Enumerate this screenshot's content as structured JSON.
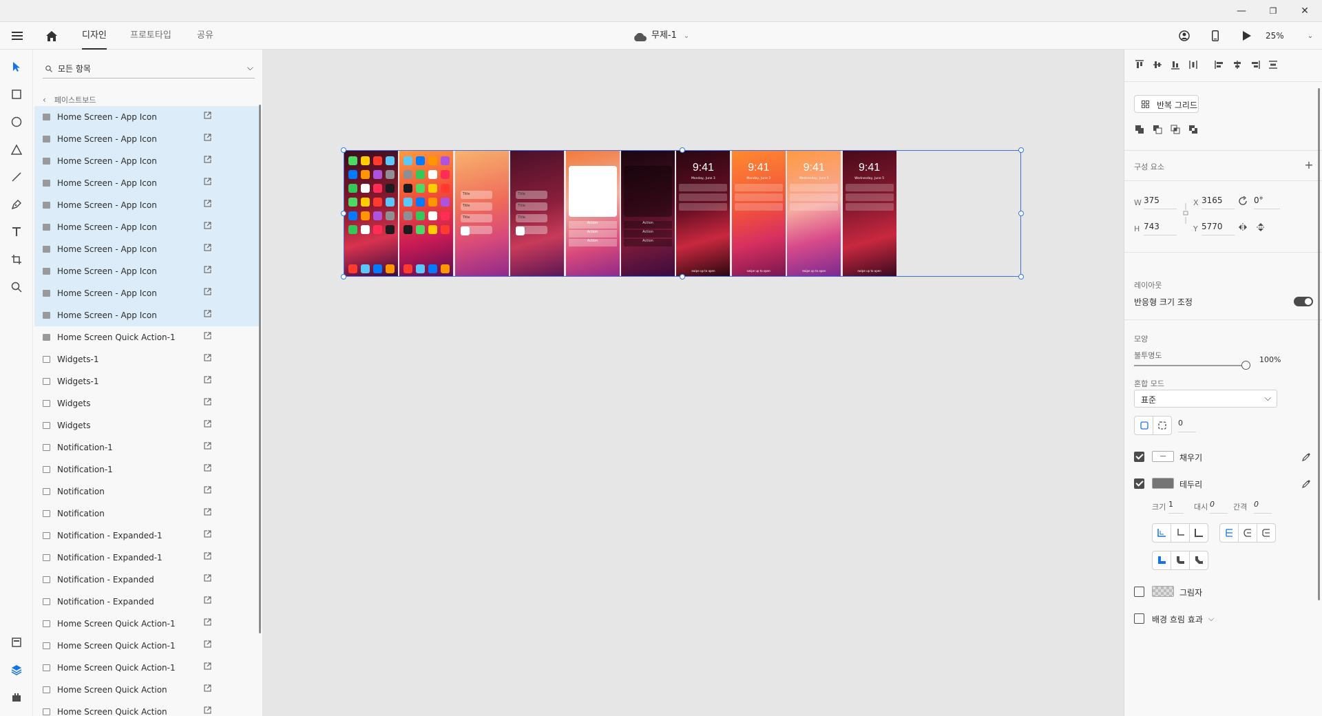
{
  "window": {
    "minimize": "—",
    "restore": "❐",
    "close": "✕"
  },
  "appbar": {
    "tabs": [
      {
        "label": "디자인"
      },
      {
        "label": "프로토타입"
      },
      {
        "label": "공유"
      }
    ],
    "document_title": "무제-1",
    "zoom": "25%"
  },
  "layers": {
    "search_placeholder": "모든 항목",
    "breadcrumb": "페이스트보드",
    "items": [
      {
        "label": "Home Screen - App Icon",
        "selected": true,
        "type": "group"
      },
      {
        "label": "Home Screen - App Icon",
        "selected": true,
        "type": "group"
      },
      {
        "label": "Home Screen - App Icon",
        "selected": true,
        "type": "group"
      },
      {
        "label": "Home Screen - App Icon",
        "selected": true,
        "type": "group"
      },
      {
        "label": "Home Screen - App Icon",
        "selected": true,
        "type": "group"
      },
      {
        "label": "Home Screen - App Icon",
        "selected": true,
        "type": "group"
      },
      {
        "label": "Home Screen - App Icon",
        "selected": true,
        "type": "group"
      },
      {
        "label": "Home Screen - App Icon",
        "selected": true,
        "type": "group"
      },
      {
        "label": "Home Screen - App Icon",
        "selected": true,
        "type": "group"
      },
      {
        "label": "Home Screen - App Icon",
        "selected": true,
        "type": "group"
      },
      {
        "label": "Home Screen Quick Action-1",
        "selected": false,
        "type": "group"
      },
      {
        "label": "Widgets-1",
        "selected": false,
        "type": "image"
      },
      {
        "label": "Widgets-1",
        "selected": false,
        "type": "image"
      },
      {
        "label": "Widgets",
        "selected": false,
        "type": "image"
      },
      {
        "label": "Widgets",
        "selected": false,
        "type": "image"
      },
      {
        "label": "Notification-1",
        "selected": false,
        "type": "image"
      },
      {
        "label": "Notification-1",
        "selected": false,
        "type": "image"
      },
      {
        "label": "Notification",
        "selected": false,
        "type": "image"
      },
      {
        "label": "Notification",
        "selected": false,
        "type": "image"
      },
      {
        "label": "Notification - Expanded-1",
        "selected": false,
        "type": "image"
      },
      {
        "label": "Notification - Expanded-1",
        "selected": false,
        "type": "image"
      },
      {
        "label": "Notification - Expanded",
        "selected": false,
        "type": "image"
      },
      {
        "label": "Notification - Expanded",
        "selected": false,
        "type": "image"
      },
      {
        "label": "Home Screen Quick Action-1",
        "selected": false,
        "type": "image"
      },
      {
        "label": "Home Screen Quick Action-1",
        "selected": false,
        "type": "image"
      },
      {
        "label": "Home Screen Quick Action-1",
        "selected": false,
        "type": "image"
      },
      {
        "label": "Home Screen Quick Action",
        "selected": false,
        "type": "image"
      },
      {
        "label": "Home Screen Quick Action",
        "selected": false,
        "type": "image"
      }
    ]
  },
  "canvas": {
    "lockscreen_time": "9:41",
    "lockscreen_dates": [
      "Monday, June 3",
      "Monday, June 3",
      "Wednesday, June 5",
      "Wednesday, June 5"
    ],
    "action_label": "Action",
    "title_label": "Title",
    "unlock_hint": "swipe up to open"
  },
  "properties": {
    "repeat_grid": "반복 그리드",
    "components_label": "구성 요소",
    "w_label": "W",
    "w_value": "375",
    "h_label": "H",
    "h_value": "743",
    "x_label": "X",
    "x_value": "3165",
    "y_label": "Y",
    "y_value": "5770",
    "rotation": "0°",
    "layout_label": "레이아웃",
    "responsive_resize": "반응형 크기 조정",
    "appearance_label": "모양",
    "opacity_label": "불투명도",
    "opacity_value": "100%",
    "opacity_fraction": 1.0,
    "blend_label": "혼합 모드",
    "blend_value": "표준",
    "corner_radius": "0",
    "fill_label": "채우기",
    "border_label": "테두리",
    "border_color": "#757575",
    "size_label": "크기",
    "size_value": "1",
    "dash_label": "대시",
    "dash_value": "0",
    "gap_label": "간격",
    "gap_value": "0",
    "shadow_label": "그림자",
    "bg_blur_label": "배경 흐림 효과"
  }
}
